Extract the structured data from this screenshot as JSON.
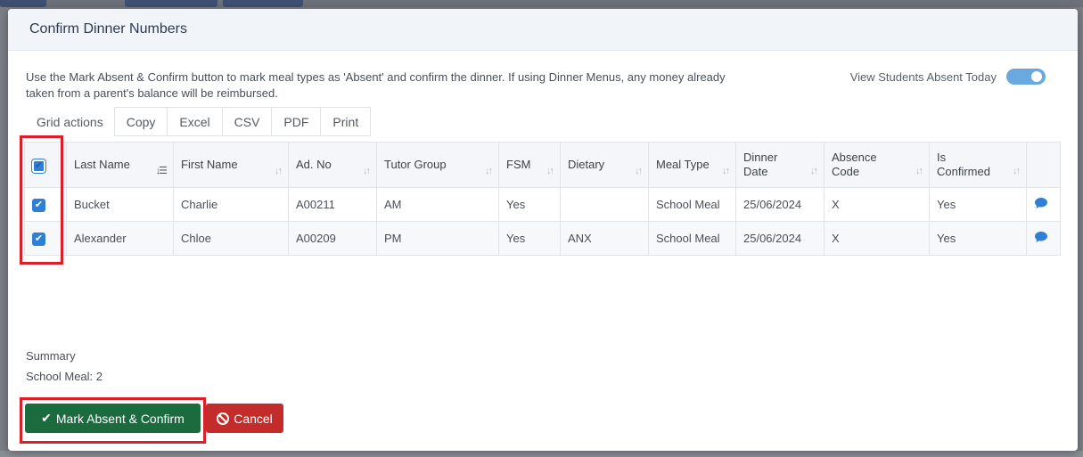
{
  "modal": {
    "title": "Confirm Dinner Numbers",
    "intro": "Use the Mark Absent & Confirm button to mark meal types as 'Absent' and confirm the dinner. If using Dinner Menus, any money already taken from a parent's balance will be reimbursed.",
    "toggle": {
      "label": "View Students Absent Today",
      "on": true
    }
  },
  "grid_actions": {
    "label": "Grid actions",
    "buttons": [
      "Copy",
      "Excel",
      "CSV",
      "PDF",
      "Print"
    ]
  },
  "table": {
    "columns": [
      {
        "l1": "Last Name",
        "l2": ""
      },
      {
        "l1": "First Name",
        "l2": ""
      },
      {
        "l1": "Ad. No",
        "l2": ""
      },
      {
        "l1": "Tutor Group",
        "l2": ""
      },
      {
        "l1": "FSM",
        "l2": ""
      },
      {
        "l1": "Dietary",
        "l2": ""
      },
      {
        "l1": "Meal Type",
        "l2": ""
      },
      {
        "l1": "Dinner",
        "l2": "Date"
      },
      {
        "l1": "Absence",
        "l2": "Code"
      },
      {
        "l1": "Is",
        "l2": "Confirmed"
      }
    ],
    "rows": [
      {
        "checked": true,
        "cells": [
          "Bucket",
          "Charlie",
          "A00211",
          "AM",
          "Yes",
          "",
          "School Meal",
          "25/06/2024",
          "X",
          "Yes"
        ]
      },
      {
        "checked": true,
        "cells": [
          "Alexander",
          "Chloe",
          "A00209",
          "PM",
          "Yes",
          "ANX",
          "School Meal",
          "25/06/2024",
          "X",
          "Yes"
        ]
      }
    ]
  },
  "summary": {
    "heading": "Summary",
    "line": "School Meal: 2"
  },
  "buttons": {
    "confirm": "Mark Absent & Confirm",
    "cancel": "Cancel"
  },
  "colors": {
    "confirm_bg": "#1b6b3f",
    "cancel_bg": "#c42b2b",
    "accent": "#2f7fd6",
    "highlight": "#d81f2a"
  },
  "icons": {
    "check": "check-icon",
    "ban": "ban-icon",
    "comment": "comment-icon",
    "sort": "sort-icon"
  }
}
